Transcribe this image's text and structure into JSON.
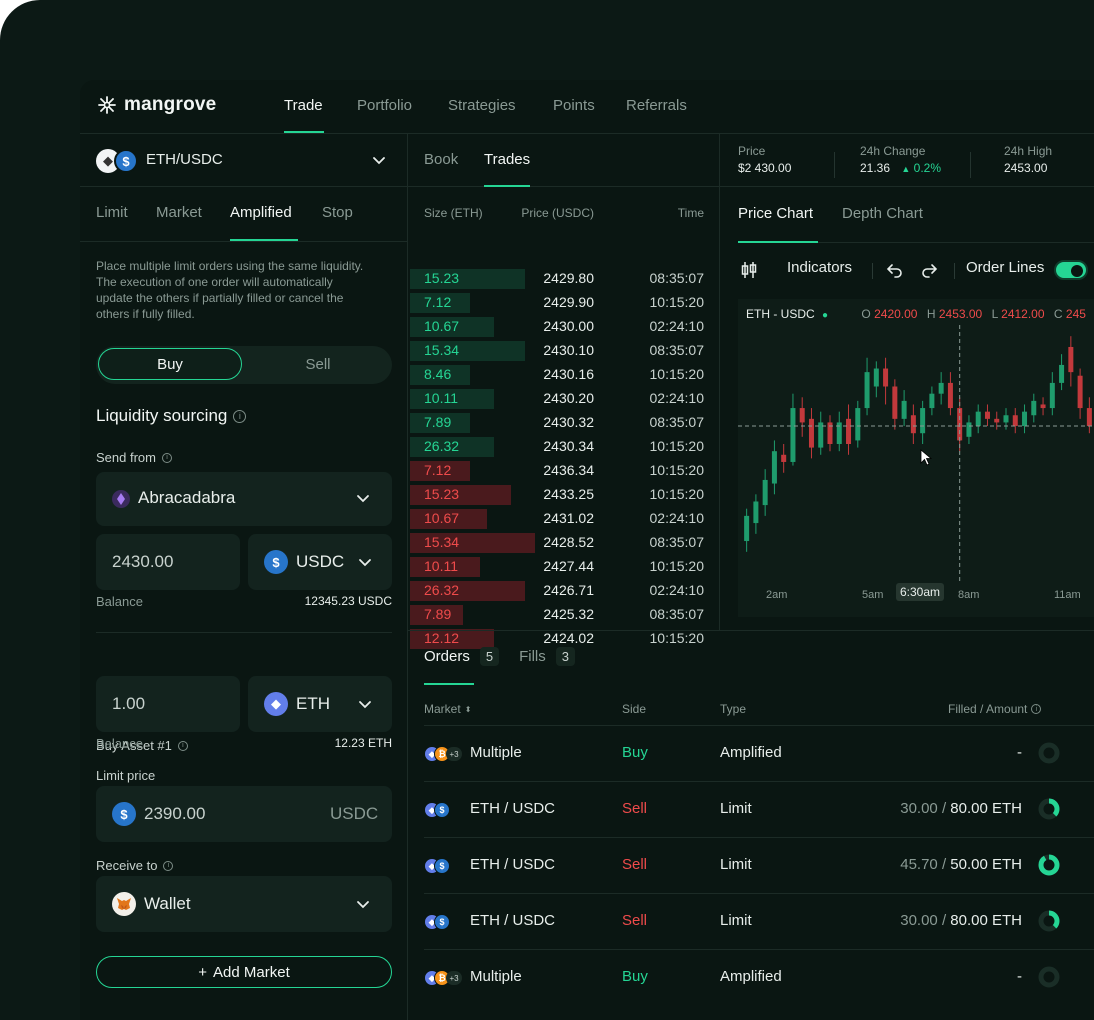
{
  "nav": {
    "brand": "mangrove",
    "items": [
      "Trade",
      "Portfolio",
      "Strategies",
      "Points",
      "Referrals"
    ]
  },
  "pair": {
    "label": "ETH/USDC"
  },
  "order_tabs": [
    "Limit",
    "Market",
    "Amplified",
    "Stop"
  ],
  "description": "Place multiple limit orders using the same liquidity. The execution of one order will automatically update the others if partially filled or cancel the others if fully filled.",
  "side": {
    "buy": "Buy",
    "sell": "Sell"
  },
  "liquidity": {
    "title": "Liquidity sourcing",
    "send_from_label": "Send from",
    "send_from_value": "Abracadabra",
    "amount": "2430.00",
    "token": "USDC",
    "balance_label": "Balance",
    "balance_value": "12345.23 USDC"
  },
  "buy_asset": {
    "label": "Buy Asset #1",
    "amount": "1.00",
    "token": "ETH",
    "balance_label": "Balance",
    "balance_value": "12.23 ETH",
    "limit_label": "Limit price",
    "limit_value": "2390.00",
    "limit_unit": "USDC",
    "receive_label": "Receive to",
    "receive_value": "Wallet"
  },
  "add_market": "Add Market",
  "book_tabs": [
    "Book",
    "Trades"
  ],
  "trades_header": {
    "size": "Size (ETH)",
    "price": "Price (USDC)",
    "time": "Time"
  },
  "trades": [
    {
      "size": "15.23",
      "price": "2429.80",
      "time": "08:35:07",
      "side": "buy",
      "depth": 0.48
    },
    {
      "size": "7.12",
      "price": "2429.90",
      "time": "10:15:20",
      "side": "buy",
      "depth": 0.25
    },
    {
      "size": "10.67",
      "price": "2430.00",
      "time": "02:24:10",
      "side": "buy",
      "depth": 0.35
    },
    {
      "size": "15.34",
      "price": "2430.10",
      "time": "08:35:07",
      "side": "buy",
      "depth": 0.48
    },
    {
      "size": "8.46",
      "price": "2430.16",
      "time": "10:15:20",
      "side": "buy",
      "depth": 0.25
    },
    {
      "size": "10.11",
      "price": "2430.20",
      "time": "02:24:10",
      "side": "buy",
      "depth": 0.35
    },
    {
      "size": "7.89",
      "price": "2430.32",
      "time": "08:35:07",
      "side": "buy",
      "depth": 0.25
    },
    {
      "size": "26.32",
      "price": "2430.34",
      "time": "10:15:20",
      "side": "buy",
      "depth": 0.35
    },
    {
      "size": "7.12",
      "price": "2436.34",
      "time": "10:15:20",
      "side": "sell",
      "depth": 0.25
    },
    {
      "size": "15.23",
      "price": "2433.25",
      "time": "10:15:20",
      "side": "sell",
      "depth": 0.42
    },
    {
      "size": "10.67",
      "price": "2431.02",
      "time": "02:24:10",
      "side": "sell",
      "depth": 0.32
    },
    {
      "size": "15.34",
      "price": "2428.52",
      "time": "08:35:07",
      "side": "sell",
      "depth": 0.52
    },
    {
      "size": "10.11",
      "price": "2427.44",
      "time": "10:15:20",
      "side": "sell",
      "depth": 0.29
    },
    {
      "size": "26.32",
      "price": "2426.71",
      "time": "02:24:10",
      "side": "sell",
      "depth": 0.48
    },
    {
      "size": "7.89",
      "price": "2425.32",
      "time": "08:35:07",
      "side": "sell",
      "depth": 0.22
    },
    {
      "size": "12.12",
      "price": "2424.02",
      "time": "10:15:20",
      "side": "sell",
      "depth": 0.35
    }
  ],
  "stats": {
    "price_label": "Price",
    "price_value": "$2 430.00",
    "change_label": "24h Change",
    "change_value": "21.36",
    "change_pct": "0.2%",
    "high_label": "24h High",
    "high_value": "2453.00"
  },
  "chart_tabs": [
    "Price Chart",
    "Depth Chart"
  ],
  "chart_tools": {
    "indicators": "Indicators",
    "order_lines": "Order Lines"
  },
  "ohlc": {
    "symbol": "ETH - USDC",
    "o_label": "O",
    "o": "2420.00",
    "h_label": "H",
    "h": "2453.00",
    "l_label": "L",
    "l": "2412.00",
    "c_label": "C",
    "c": "245"
  },
  "chart_data": {
    "type": "candlestick",
    "x_ticks": [
      "2am",
      "5am",
      "6:30am",
      "8am",
      "11am"
    ],
    "candles": [
      {
        "o": 2403,
        "c": 2410,
        "h": 2412,
        "l": 2400
      },
      {
        "o": 2408,
        "c": 2414,
        "h": 2416,
        "l": 2405
      },
      {
        "o": 2413,
        "c": 2420,
        "h": 2423,
        "l": 2410
      },
      {
        "o": 2419,
        "c": 2428,
        "h": 2431,
        "l": 2416
      },
      {
        "o": 2427,
        "c": 2425,
        "h": 2430,
        "l": 2422
      },
      {
        "o": 2425,
        "c": 2440,
        "h": 2444,
        "l": 2424
      },
      {
        "o": 2440,
        "c": 2436,
        "h": 2443,
        "l": 2432
      },
      {
        "o": 2437,
        "c": 2429,
        "h": 2440,
        "l": 2426
      },
      {
        "o": 2429,
        "c": 2436,
        "h": 2439,
        "l": 2427
      },
      {
        "o": 2436,
        "c": 2430,
        "h": 2438,
        "l": 2428
      },
      {
        "o": 2430,
        "c": 2436,
        "h": 2439,
        "l": 2428
      },
      {
        "o": 2437,
        "c": 2430,
        "h": 2441,
        "l": 2427
      },
      {
        "o": 2431,
        "c": 2440,
        "h": 2442,
        "l": 2429
      },
      {
        "o": 2440,
        "c": 2450,
        "h": 2454,
        "l": 2438
      },
      {
        "o": 2446,
        "c": 2451,
        "h": 2453,
        "l": 2443
      },
      {
        "o": 2451,
        "c": 2446,
        "h": 2454,
        "l": 2441
      },
      {
        "o": 2446,
        "c": 2437,
        "h": 2448,
        "l": 2434
      },
      {
        "o": 2437,
        "c": 2442,
        "h": 2445,
        "l": 2435
      },
      {
        "o": 2438,
        "c": 2433,
        "h": 2441,
        "l": 2430
      },
      {
        "o": 2433,
        "c": 2440,
        "h": 2442,
        "l": 2430
      },
      {
        "o": 2440,
        "c": 2444,
        "h": 2446,
        "l": 2438
      },
      {
        "o": 2444,
        "c": 2447,
        "h": 2450,
        "l": 2441
      },
      {
        "o": 2447,
        "c": 2440,
        "h": 2450,
        "l": 2438
      },
      {
        "o": 2440,
        "c": 2431,
        "h": 2443,
        "l": 2428
      },
      {
        "o": 2432,
        "c": 2436,
        "h": 2438,
        "l": 2430
      },
      {
        "o": 2435,
        "c": 2439,
        "h": 2441,
        "l": 2433
      },
      {
        "o": 2439,
        "c": 2437,
        "h": 2441,
        "l": 2435
      },
      {
        "o": 2437,
        "c": 2436,
        "h": 2439,
        "l": 2434
      },
      {
        "o": 2436,
        "c": 2438,
        "h": 2440,
        "l": 2434
      },
      {
        "o": 2438,
        "c": 2435,
        "h": 2440,
        "l": 2433
      },
      {
        "o": 2435,
        "c": 2439,
        "h": 2441,
        "l": 2433
      },
      {
        "o": 2438,
        "c": 2442,
        "h": 2444,
        "l": 2436
      },
      {
        "o": 2441,
        "c": 2440,
        "h": 2443,
        "l": 2438
      },
      {
        "o": 2440,
        "c": 2447,
        "h": 2450,
        "l": 2438
      },
      {
        "o": 2447,
        "c": 2452,
        "h": 2455,
        "l": 2445
      },
      {
        "o": 2457,
        "c": 2450,
        "h": 2460,
        "l": 2446
      },
      {
        "o": 2449,
        "c": 2440,
        "h": 2451,
        "l": 2437
      },
      {
        "o": 2440,
        "c": 2435,
        "h": 2443,
        "l": 2433
      }
    ],
    "crosshair_price": 2435,
    "crosshair_index": 23
  },
  "orders": {
    "tabs": [
      {
        "label": "Orders",
        "count": "5"
      },
      {
        "label": "Fills",
        "count": "3"
      }
    ],
    "headers": {
      "market": "Market",
      "side": "Side",
      "type": "Type",
      "filled": "Filled / Amount"
    },
    "rows": [
      {
        "market": "Multiple",
        "side": "Buy",
        "type": "Amplified",
        "filled": "",
        "amount": "-",
        "icons": "multi",
        "fill_fraction": 0
      },
      {
        "market": "ETH / USDC",
        "side": "Sell",
        "type": "Limit",
        "filled": "30.00 / ",
        "amount": "80.00 ETH",
        "icons": "pair",
        "fill_fraction": 0.375
      },
      {
        "market": "ETH / USDC",
        "side": "Sell",
        "type": "Limit",
        "filled": "45.70 / ",
        "amount": "50.00 ETH",
        "icons": "pair",
        "fill_fraction": 0.914
      },
      {
        "market": "ETH / USDC",
        "side": "Sell",
        "type": "Limit",
        "filled": "30.00 / ",
        "amount": "80.00 ETH",
        "icons": "pair",
        "fill_fraction": 0.375
      },
      {
        "market": "Multiple",
        "side": "Buy",
        "type": "Amplified",
        "filled": "",
        "amount": "-",
        "icons": "multi",
        "fill_fraction": 0
      }
    ],
    "multi_badge": "+3"
  },
  "colors": {
    "accent": "#25d594",
    "sell": "#ef4b4b",
    "bg": "#0a1612"
  }
}
